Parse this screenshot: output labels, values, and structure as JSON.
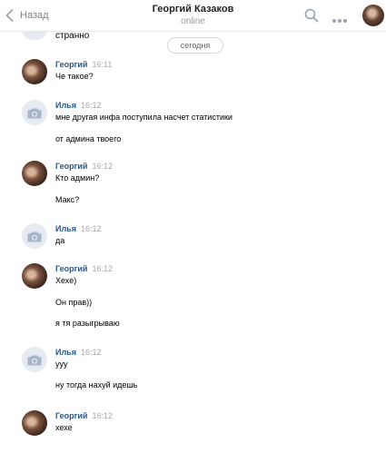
{
  "header": {
    "back_label": "Назад",
    "title": "Георгий Казаков",
    "status": "online"
  },
  "feed": {
    "previous_text": "странно",
    "date_divider": "сегодня",
    "messages": [
      {
        "author": "Георгий",
        "time": "16:11",
        "avatar": "profile-photo",
        "lines": [
          "Че такое?"
        ]
      },
      {
        "author": "Илья",
        "time": "16:12",
        "avatar": "camera-icon",
        "lines": [
          "мне другая инфа поступила насчет статистики",
          "от админа твоего"
        ]
      },
      {
        "author": "Георгий",
        "time": "16:12",
        "avatar": "profile-photo",
        "lines": [
          "Кто админ?",
          "Макс?"
        ]
      },
      {
        "author": "Илья",
        "time": "16:12",
        "avatar": "camera-icon",
        "lines": [
          "да"
        ]
      },
      {
        "author": "Георгий",
        "time": "16:12",
        "avatar": "profile-photo",
        "lines": [
          "Хехе)",
          "Он прав))",
          "я тя разыгрываю"
        ]
      },
      {
        "author": "Илья",
        "time": "16:12",
        "avatar": "camera-icon",
        "lines": [
          "ууу",
          "ну тогда нахуй идешь"
        ]
      },
      {
        "author": "Георгий",
        "time": "16:12",
        "avatar": "profile-photo",
        "lines": [
          "хехе"
        ]
      }
    ]
  },
  "colors": {
    "author_link": "#2a5885",
    "time": "#a8a8a8",
    "divider": "#e7e8ec",
    "camera_avatar_bg": "#e6ebf1",
    "camera_icon": "#a7b7c9"
  }
}
